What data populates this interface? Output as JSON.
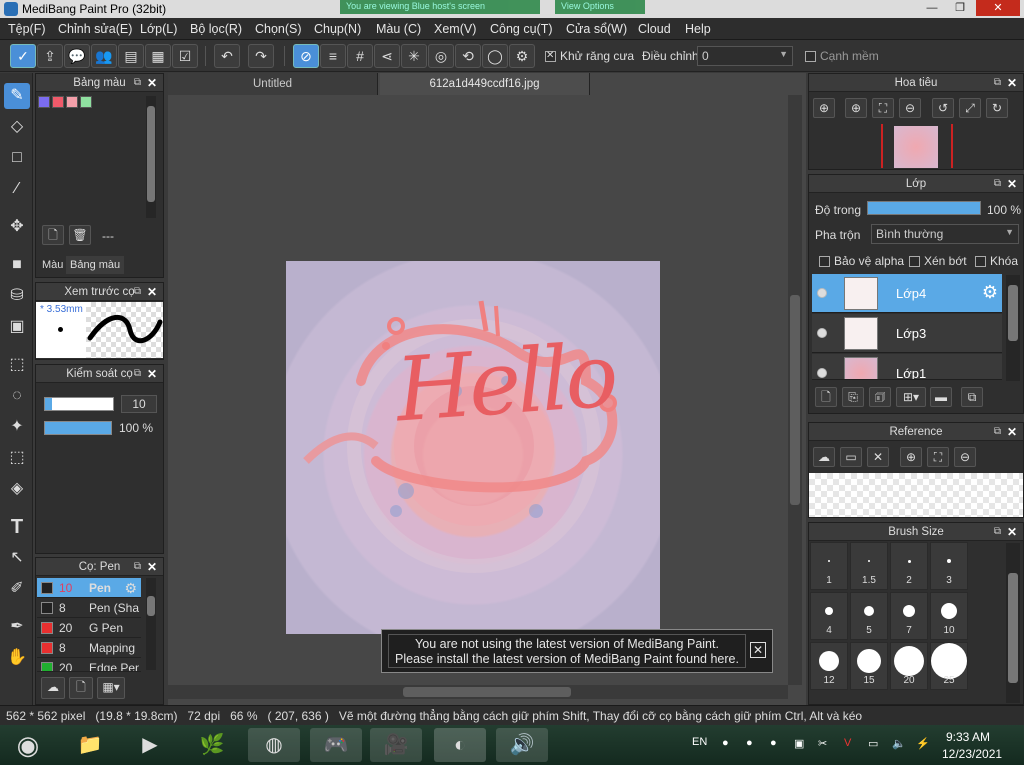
{
  "window": {
    "title": "MediBang Paint Pro (32bit)",
    "bg_windows": [
      "You are viewing Blue host's screen",
      "View Options"
    ],
    "min": "—",
    "max": "❐",
    "close": "✕"
  },
  "menu": [
    "Tệp(F)",
    "Chỉnh sửa(E)",
    "Bộ lọc(R)",
    "Lớp(L)",
    "Chọn(S)",
    "Chụp(N)",
    "Màu (C)",
    "Xem(V)",
    "Công cụ(T)",
    "Cửa sổ(W)",
    "Cloud",
    "Help"
  ],
  "toolbar": {
    "antialias_label": "Khử răng cưa",
    "adjust_label": "Điều chỉnh",
    "adjust_value": "0",
    "smooth_label": "Cạnh mềm"
  },
  "panels": {
    "color_palette": {
      "title": "Bảng màu",
      "dash": "---",
      "tabs": [
        "Màu",
        "Bảng màu"
      ],
      "swatches": [
        "#7b6cf0",
        "#f05a6a",
        "#f5a0aa",
        "#8fe0a0"
      ]
    },
    "brush_preview": {
      "title": "Xem trước cọ",
      "size": "* 3.53mm"
    },
    "brush_control": {
      "title": "Kiểm soát cọ",
      "size_value": "10",
      "opacity_value": "100 %",
      "size_fraction": 0.1,
      "opacity_fraction": 1.0
    },
    "brush_list": {
      "title": "Cọ: Pen",
      "items": [
        {
          "color": "#222222",
          "size": "10",
          "name": "Pen",
          "active": true
        },
        {
          "color": "#222222",
          "size": "8",
          "name": "Pen (Sha"
        },
        {
          "color": "#e83030",
          "size": "20",
          "name": "G Pen"
        },
        {
          "color": "#e83030",
          "size": "8",
          "name": "Mapping I"
        },
        {
          "color": "#20b030",
          "size": "20",
          "name": "Edge Pen"
        }
      ]
    }
  },
  "documents": {
    "tabs": [
      "Untitled",
      "612a1d449ccdf16.jpg"
    ],
    "artwork_text": "Hello"
  },
  "notice": {
    "line1": "You are not using the latest version of MediBang Paint.",
    "line2": "Please install the latest version of MediBang Paint found here."
  },
  "navigator": {
    "title": "Hoa tiêu"
  },
  "layers": {
    "title": "Lớp",
    "opacity_label": "Độ trong",
    "opacity_value": "100 %",
    "opacity_fraction": 1.0,
    "blend_label": "Pha trộn",
    "blend_value": "Bình thường",
    "protect_alpha": "Bảo vệ alpha",
    "clipping": "Xén bớt",
    "lock": "Khóa",
    "items": [
      {
        "name": "Lớp4",
        "active": true
      },
      {
        "name": "Lớp3"
      },
      {
        "name": "Lớp1"
      }
    ]
  },
  "reference": {
    "title": "Reference"
  },
  "brush_size": {
    "title": "Brush Size",
    "sizes": [
      "1",
      "1.5",
      "2",
      "3",
      "4",
      "5",
      "7",
      "10",
      "12",
      "15",
      "20",
      "25"
    ]
  },
  "status": {
    "text": "562 * 562 pixel   (19.8 * 19.8cm)   72 dpi   66 %   ( 207, 636 )   Vẽ một đường thẳng bằng cách giữ phím Shift, Thay đổi cỡ cọ bằng cách giữ phím Ctrl, Alt và kéo"
  },
  "taskbar": {
    "lang": "EN",
    "time": "9:33 AM",
    "date": "12/23/2021"
  }
}
